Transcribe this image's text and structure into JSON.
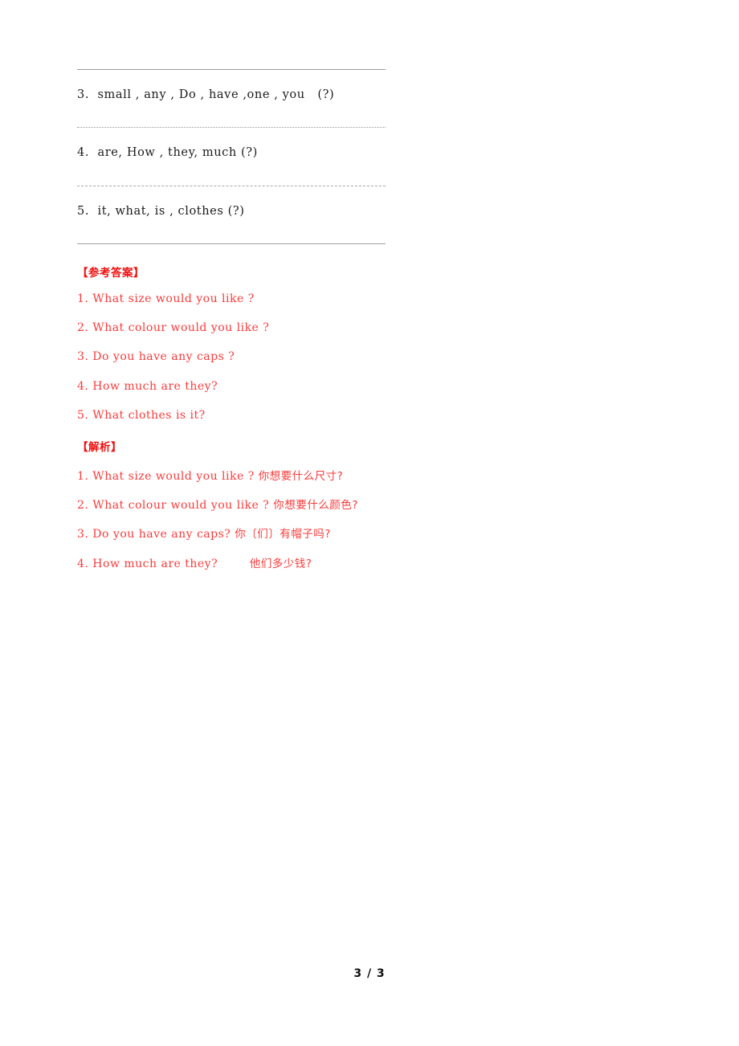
{
  "document": {
    "page_footer": "3 / 3"
  },
  "questions": [
    {
      "number": "3.",
      "text": "3.  small , any , Do , have ,one , you   (?)"
    },
    {
      "number": "4.",
      "text": "4.  are, How , they, much (?)"
    },
    {
      "number": "5.",
      "text": "5.  it, what, is , clothes (?)"
    }
  ],
  "answers_section": {
    "heading": "【参考答案】",
    "items": [
      "1. What size would you like ?",
      "2. What colour would you like ?",
      "3. Do you have any caps ?",
      "4. How much are they?",
      "5. What clothes is it?"
    ]
  },
  "analysis_section": {
    "heading": "【解析】",
    "items": [
      {
        "en": "1. What size would you like ? ",
        "cn": "你想要什么尺寸?"
      },
      {
        "en": "2. What colour would you like ? ",
        "cn": "你想要什么颜色?"
      },
      {
        "en": "3. Do you have any caps? ",
        "cn": "你〔们〕有帽子吗?"
      },
      {
        "en": "4. How much are they?        ",
        "cn": "他们多少钱?"
      }
    ]
  },
  "colors": {
    "red_heading": "#f01010",
    "red_text": "#fb3a3a",
    "rule_gray": "#9a9a9a",
    "body_text": "#1a1a1a"
  }
}
